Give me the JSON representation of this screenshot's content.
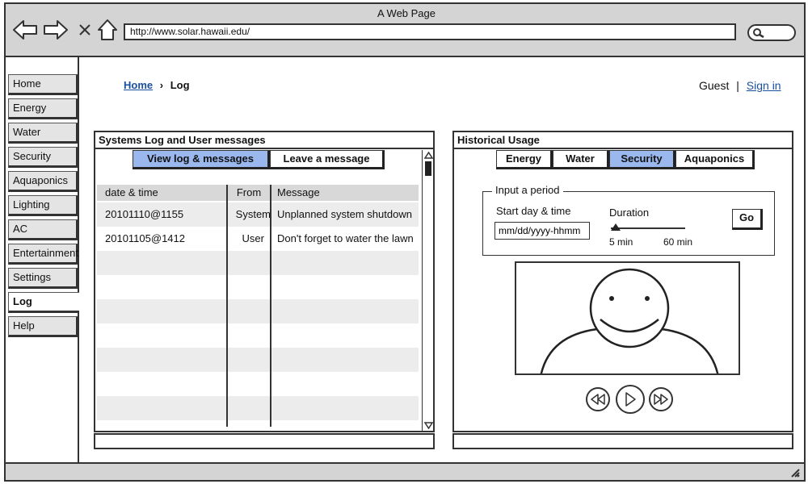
{
  "window": {
    "title": "A Web Page"
  },
  "browser": {
    "url": "http://www.solar.hawaii.edu/"
  },
  "sidebar": {
    "items": [
      {
        "label": "Home"
      },
      {
        "label": "Energy"
      },
      {
        "label": "Water"
      },
      {
        "label": "Security"
      },
      {
        "label": "Aquaponics"
      },
      {
        "label": "Lighting"
      },
      {
        "label": "AC"
      },
      {
        "label": "Entertainment"
      },
      {
        "label": "Settings"
      },
      {
        "label": "Log",
        "active": true
      },
      {
        "label": "Help"
      }
    ]
  },
  "breadcrumb": {
    "home": "Home",
    "separator": "›",
    "current": "Log"
  },
  "user": {
    "name": "Guest",
    "separator": "|",
    "sign_in": "Sign in"
  },
  "log_panel": {
    "title": "Systems Log and User messages",
    "tabs": [
      {
        "label": "View log & messages",
        "selected": true
      },
      {
        "label": "Leave a message",
        "selected": false
      }
    ],
    "columns": [
      "date & time",
      "From",
      "Message"
    ],
    "rows": [
      {
        "datetime": "20101110@1155",
        "from": "System",
        "message": "Unplanned system shutdown"
      },
      {
        "datetime": "20101105@1412",
        "from": "User",
        "message": "Don't forget to water the lawn"
      }
    ]
  },
  "history_panel": {
    "title": "Historical Usage",
    "tabs": [
      {
        "label": "Energy",
        "selected": false
      },
      {
        "label": "Water",
        "selected": false
      },
      {
        "label": "Security",
        "selected": true
      },
      {
        "label": "Aquaponics",
        "selected": false
      }
    ],
    "period": {
      "legend": "Input a period",
      "start_label": "Start day & time",
      "start_value": "mm/dd/yyyy-hhmm",
      "duration_label": "Duration",
      "duration_min": "5 min",
      "duration_max": "60 min",
      "go_label": "Go"
    }
  },
  "colors": {
    "selected_tab": "#9ab8ee",
    "link": "#1a4fa0",
    "chrome": "#d4d4d4"
  }
}
